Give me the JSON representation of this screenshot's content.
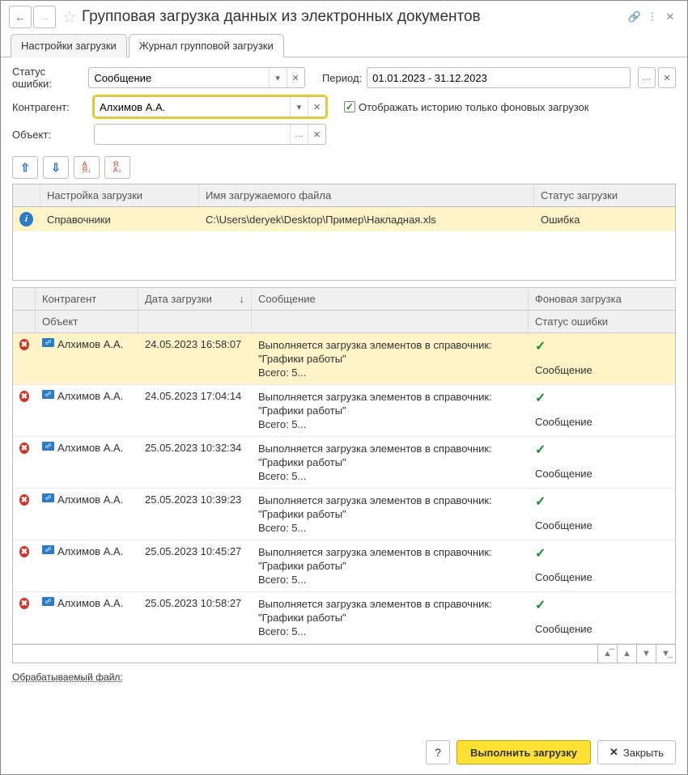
{
  "header": {
    "title": "Групповая загрузка данных из электронных документов"
  },
  "tabs": {
    "settings": "Настройки загрузки",
    "journal": "Журнал групповой загрузки"
  },
  "filters": {
    "error_status_label": "Статус ошибки:",
    "error_status_value": "Сообщение",
    "period_label": "Период:",
    "period_value": "01.01.2023 - 31.12.2023",
    "counterparty_label": "Контрагент:",
    "counterparty_value": "Алхимов А.А.",
    "object_label": "Объект:",
    "object_value": "",
    "show_history_label": "Отображать историю только фоновых загрузок"
  },
  "top_table": {
    "headers": {
      "settings": "Настройка загрузки",
      "file": "Имя загружаемого файла",
      "status": "Статус загрузки"
    },
    "row": {
      "settings": "Справочники",
      "file": "C:\\Users\\deryek\\Desktop\\Пример\\Накладная.xls",
      "status": "Ошибка"
    }
  },
  "grid": {
    "headers": {
      "counterparty": "Контрагент",
      "date": "Дата загрузки",
      "message": "Сообщение",
      "background": "Фоновая загрузка",
      "object": "Объект",
      "error_status": "Статус ошибки"
    },
    "message_line1": "Выполняется загрузка элементов в справочник:",
    "message_line2": "\"Графики работы\"",
    "message_line3": "Всего: 5...",
    "status_text": "Сообщение",
    "rows": [
      {
        "counterparty": "Алхимов А.А.",
        "date": "24.05.2023 16:58:07"
      },
      {
        "counterparty": "Алхимов А.А.",
        "date": "24.05.2023 17:04:14"
      },
      {
        "counterparty": "Алхимов А.А.",
        "date": "25.05.2023 10:32:34"
      },
      {
        "counterparty": "Алхимов А.А.",
        "date": "25.05.2023 10:39:23"
      },
      {
        "counterparty": "Алхимов А.А.",
        "date": "25.05.2023 10:45:27"
      },
      {
        "counterparty": "Алхимов А.А.",
        "date": "25.05.2023 10:58:27"
      }
    ]
  },
  "processing_label": "Обрабатываемый файл:",
  "footer": {
    "execute": "Выполнить загрузку",
    "close": "Закрыть"
  }
}
